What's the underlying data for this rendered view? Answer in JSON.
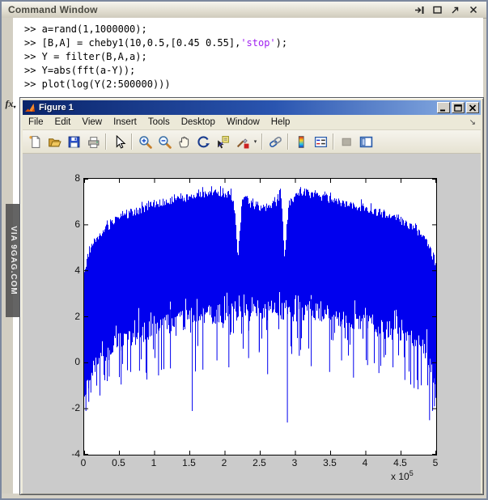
{
  "colors": {
    "desktop_beige": "#d6d2c6",
    "cmd_title_bg": "#dcd8ca",
    "string_purple": "#a020f0",
    "fig_titlebar_blue": "#0a246a",
    "canvas_gray": "#cbcbcb",
    "plot_blue": "#0000ee"
  },
  "command_window": {
    "title": "Command Window",
    "titlebar_icons": [
      "dock-icon",
      "maximize-icon",
      "undock-icon",
      "close-icon"
    ],
    "fx_label": "fx",
    "prompt_lines": [
      {
        "segments": [
          {
            "t": ">> a=rand(1,1000000);",
            "c": "code"
          }
        ]
      },
      {
        "segments": [
          {
            "t": ">> [B,A] = cheby1(10,0.5,[0.45 0.55],",
            "c": "code"
          },
          {
            "t": "'stop'",
            "c": "string"
          },
          {
            "t": ");",
            "c": "code"
          }
        ]
      },
      {
        "segments": [
          {
            "t": ">> Y = filter(B,A,a);",
            "c": "code"
          }
        ]
      },
      {
        "segments": [
          {
            "t": ">> Y=abs(fft(a-Y));",
            "c": "code"
          }
        ]
      },
      {
        "segments": [
          {
            "t": ">> plot(log(Y(2:500000)))",
            "c": "code"
          }
        ]
      }
    ]
  },
  "watermark": {
    "text": "VIA 9GAG.COM"
  },
  "figure_window": {
    "title": "Figure 1",
    "window_buttons": [
      "minimize-button",
      "maximize-button",
      "close-button"
    ],
    "menu": [
      "File",
      "Edit",
      "View",
      "Insert",
      "Tools",
      "Desktop",
      "Window",
      "Help"
    ],
    "menu_overflow_arrow": "↘",
    "toolbar_icons": [
      "new-figure-icon",
      "open-file-icon",
      "save-figure-icon",
      "print-figure-icon",
      "edit-plot-icon",
      "zoom-in-icon",
      "zoom-out-icon",
      "pan-icon",
      "rotate-3d-icon",
      "data-cursor-icon",
      "brush-data-icon",
      "link-plot-icon",
      "insert-colorbar-icon",
      "insert-legend-icon",
      "hide-plot-tools-icon",
      "show-plot-tools-icon"
    ]
  },
  "chart_data": {
    "type": "line",
    "title": "",
    "xlabel": "",
    "ylabel": "",
    "series_name": "plot(log(Y(2:500000)))",
    "line_color": "#0000ee",
    "grid": false,
    "xlim": [
      0,
      500000
    ],
    "ylim": [
      -4,
      8
    ],
    "x_units_max": 5,
    "exp_base": "x 10",
    "exp_sup": "5",
    "xticks": [
      0,
      0.5,
      1,
      1.5,
      2,
      2.5,
      3,
      3.5,
      4,
      4.5,
      5
    ],
    "xtick_labels": [
      "0",
      "0.5",
      "1",
      "1.5",
      "2",
      "2.5",
      "3",
      "3.5",
      "4",
      "4.5",
      "5"
    ],
    "yticks": [
      -4,
      -2,
      0,
      2,
      4,
      6,
      8
    ],
    "ytick_labels": [
      "-4",
      "-2",
      "0",
      "2",
      "4",
      "6",
      "8"
    ],
    "seed": 1337,
    "envelope": {
      "x_top": [
        0,
        0.04,
        0.1,
        0.2,
        0.35,
        0.5,
        0.7,
        1.0,
        1.3,
        1.6,
        1.9,
        2.05,
        2.12,
        2.18,
        2.24,
        2.28,
        2.35,
        2.5,
        2.65,
        2.74,
        2.79,
        2.84,
        2.9,
        3.0,
        3.15,
        3.4,
        3.6,
        3.9,
        4.2,
        4.5,
        4.7,
        4.85,
        4.95,
        5.0
      ],
      "top": [
        3.85,
        4.6,
        5.05,
        5.5,
        5.95,
        6.3,
        6.55,
        6.9,
        7.1,
        7.25,
        7.35,
        7.3,
        7.0,
        4.6,
        7.1,
        7.3,
        6.85,
        6.7,
        6.8,
        7.0,
        7.5,
        4.6,
        6.9,
        7.3,
        7.35,
        7.15,
        7.0,
        6.75,
        6.5,
        6.15,
        5.8,
        5.35,
        4.6,
        3.9
      ],
      "x_bottom": [
        0,
        0.05,
        0.12,
        0.25,
        0.4,
        0.6,
        0.9,
        1.2,
        1.6,
        2.0,
        2.5,
        3.0,
        3.4,
        3.8,
        4.2,
        4.5,
        4.7,
        4.85,
        4.95,
        5.0
      ],
      "bottom": [
        -1.6,
        -0.9,
        -0.2,
        0.35,
        0.7,
        1.0,
        1.4,
        1.7,
        2.0,
        2.2,
        2.3,
        2.25,
        2.1,
        1.85,
        1.55,
        1.2,
        0.85,
        0.4,
        -0.4,
        -1.2
      ]
    },
    "deep_spikes": [
      {
        "x": 0.02,
        "y": -2.1
      },
      {
        "x": 0.06,
        "y": -1.7
      },
      {
        "x": 0.09,
        "y": -1.3
      },
      {
        "x": 0.35,
        "y": -0.6
      },
      {
        "x": 0.52,
        "y": -0.95
      },
      {
        "x": 0.78,
        "y": -0.35
      },
      {
        "x": 1.05,
        "y": -0.55
      },
      {
        "x": 1.22,
        "y": -0.25
      },
      {
        "x": 1.53,
        "y": -2.1
      },
      {
        "x": 1.68,
        "y": -0.3
      },
      {
        "x": 1.88,
        "y": 0.1
      },
      {
        "x": 2.05,
        "y": -0.2
      },
      {
        "x": 2.33,
        "y": 0.2
      },
      {
        "x": 2.48,
        "y": 0.45
      },
      {
        "x": 2.6,
        "y": -0.5
      },
      {
        "x": 2.88,
        "y": -2.6
      },
      {
        "x": 3.05,
        "y": 0.3
      },
      {
        "x": 3.22,
        "y": -0.15
      },
      {
        "x": 3.48,
        "y": -0.4
      },
      {
        "x": 3.65,
        "y": 0.1
      },
      {
        "x": 3.82,
        "y": -0.65
      },
      {
        "x": 4.02,
        "y": -0.1
      },
      {
        "x": 4.18,
        "y": -0.45
      },
      {
        "x": 4.38,
        "y": -0.2
      },
      {
        "x": 4.55,
        "y": -0.75
      },
      {
        "x": 4.68,
        "y": -1.1
      },
      {
        "x": 4.9,
        "y": -2.5
      },
      {
        "x": 4.97,
        "y": -1.9
      }
    ]
  }
}
